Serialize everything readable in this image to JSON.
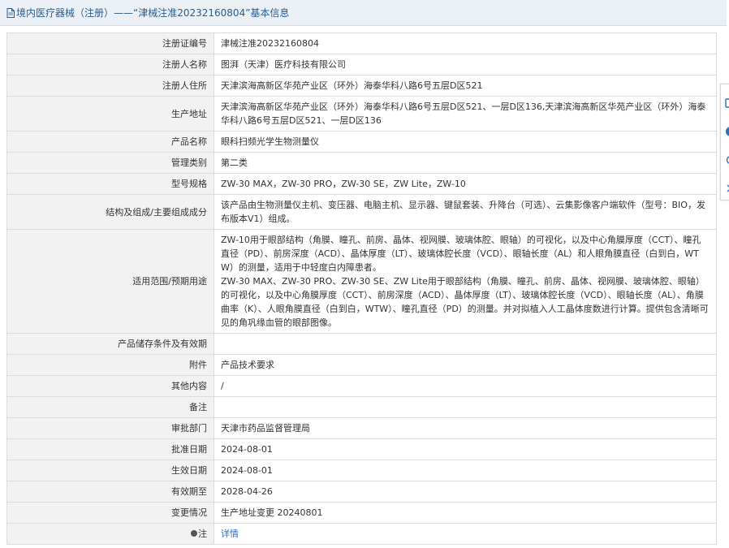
{
  "header": {
    "title": "境内医疗器械（注册）——“津械注准20232160804”基本信息"
  },
  "rows": [
    {
      "label": "注册证编号",
      "value": [
        "津械注准20232160804"
      ]
    },
    {
      "label": "注册人名称",
      "value": [
        "图湃（天津）医疗科技有限公司"
      ]
    },
    {
      "label": "注册人住所",
      "value": [
        "天津滨海高新区华苑产业区（环外）海泰华科八路6号五层D区521"
      ]
    },
    {
      "label": "生产地址",
      "value": [
        "天津滨海高新区华苑产业区（环外）海泰华科八路6号五层D区521、一层D区136,天津滨海高新区华苑产业区（环外）海泰华科八路6号五层D区521、一层D区136"
      ]
    },
    {
      "label": "产品名称",
      "value": [
        "眼科扫频光学生物测量仪"
      ]
    },
    {
      "label": "管理类别",
      "value": [
        "第二类"
      ]
    },
    {
      "label": "型号规格",
      "value": [
        "ZW-30 MAX，ZW-30 PRO，ZW-30 SE，ZW Lite，ZW-10"
      ]
    },
    {
      "label": "结构及组成/主要组成成分",
      "value": [
        "该产品由生物测量仪主机、变压器、电脑主机、显示器、键鼠套装、升降台（可选）、云集影像客户端软件（型号：BIO，发布版本V1）组成。"
      ]
    },
    {
      "label": "适用范围/预期用途",
      "value": [
        "ZW-10用于眼部结构（角膜、瞳孔、前房、晶体、视网膜、玻璃体腔、眼轴）的可视化，以及中心角膜厚度（CCT）、瞳孔直径（PD）、前房深度（ACD）、晶体厚度（LT）、玻璃体腔长度（VCD）、眼轴长度（AL）和人眼角膜直径（白到白，WTW）的测量，适用于中轻度白内障患者。",
        "ZW-30 MAX、ZW-30 PRO、ZW-30 SE、ZW Lite用于眼部结构（角膜、瞳孔、前房、晶体、视网膜、玻璃体腔、眼轴）的可视化，以及中心角膜厚度（CCT）、前房深度（ACD）、晶体厚度（LT）、玻璃体腔长度（VCD）、眼轴长度（AL）、角膜曲率（K）、人眼角膜直径（白到白，WTW）、瞳孔直径（PD）的测量。并对拟植入人工晶体度数进行计算。提供包含清晰可见的角巩缘血管的眼部图像。"
      ]
    },
    {
      "label": "产品储存条件及有效期",
      "value": [
        ""
      ]
    },
    {
      "label": "附件",
      "value": [
        "产品技术要求"
      ]
    },
    {
      "label": "其他内容",
      "value": [
        "/"
      ]
    },
    {
      "label": "备注",
      "value": [
        ""
      ]
    },
    {
      "label": "审批部门",
      "value": [
        "天津市药品监督管理局"
      ]
    },
    {
      "label": "批准日期",
      "value": [
        "2024-08-01"
      ]
    },
    {
      "label": "生效日期",
      "value": [
        "2024-08-01"
      ]
    },
    {
      "label": "有效期至",
      "value": [
        "2028-04-26"
      ]
    },
    {
      "label": "变更情况",
      "value": [
        "生产地址变更 20240801"
      ]
    }
  ],
  "note_row": {
    "label": "注",
    "link": "详情"
  },
  "colors": {
    "title_text": "#2a5d8f",
    "title_bg": "#eaf0f6",
    "label_bg": "#f2f2f2",
    "border": "#dcdcdc",
    "link": "#2e6fb7"
  },
  "icons": [
    "document-icon",
    "note-icon",
    "side-tool-icons"
  ]
}
